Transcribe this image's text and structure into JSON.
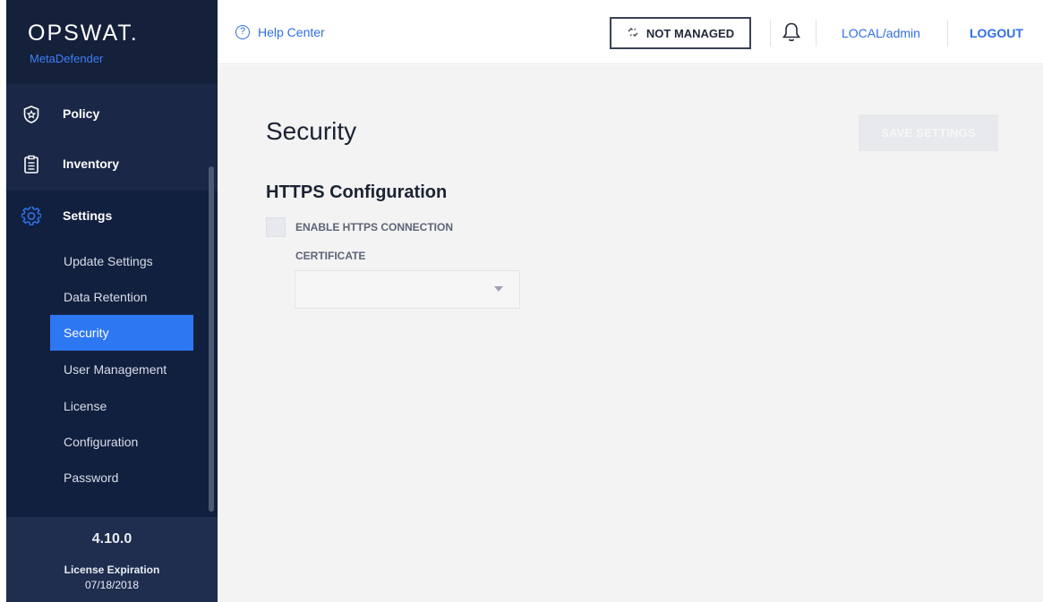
{
  "brand": {
    "name": "OPSWAT.",
    "product": "MetaDefender"
  },
  "sidebar": {
    "items": [
      {
        "label": "Policy",
        "icon": "shield-star-icon"
      },
      {
        "label": "Inventory",
        "icon": "clipboard-icon"
      },
      {
        "label": "Settings",
        "icon": "gear-icon"
      }
    ],
    "settings_subitems": [
      {
        "label": "Update Settings"
      },
      {
        "label": "Data Retention"
      },
      {
        "label": "Security",
        "active": true
      },
      {
        "label": "User Management"
      },
      {
        "label": "License"
      },
      {
        "label": "Configuration"
      },
      {
        "label": "Password"
      }
    ],
    "footer": {
      "version": "4.10.0",
      "license_label": "License Expiration",
      "license_date": "07/18/2018"
    }
  },
  "topbar": {
    "help_label": "Help Center",
    "help_icon": "question-circle-icon",
    "managed_label": "NOT MANAGED",
    "managed_icon": "broken-link-icon",
    "bell_icon": "bell-icon",
    "user_label": "LOCAL/admin",
    "logout_label": "LOGOUT"
  },
  "main": {
    "title": "Security",
    "save_label": "SAVE SETTINGS",
    "section_title": "HTTPS Configuration",
    "enable_https_label": "ENABLE HTTPS CONNECTION",
    "enable_https_checked": false,
    "certificate_label": "CERTIFICATE",
    "certificate_value": ""
  },
  "colors": {
    "sidebar_bg": "#1a2746",
    "accent": "#2d77f2",
    "link": "#2f6fe3",
    "main_bg": "#f3f3f3"
  }
}
